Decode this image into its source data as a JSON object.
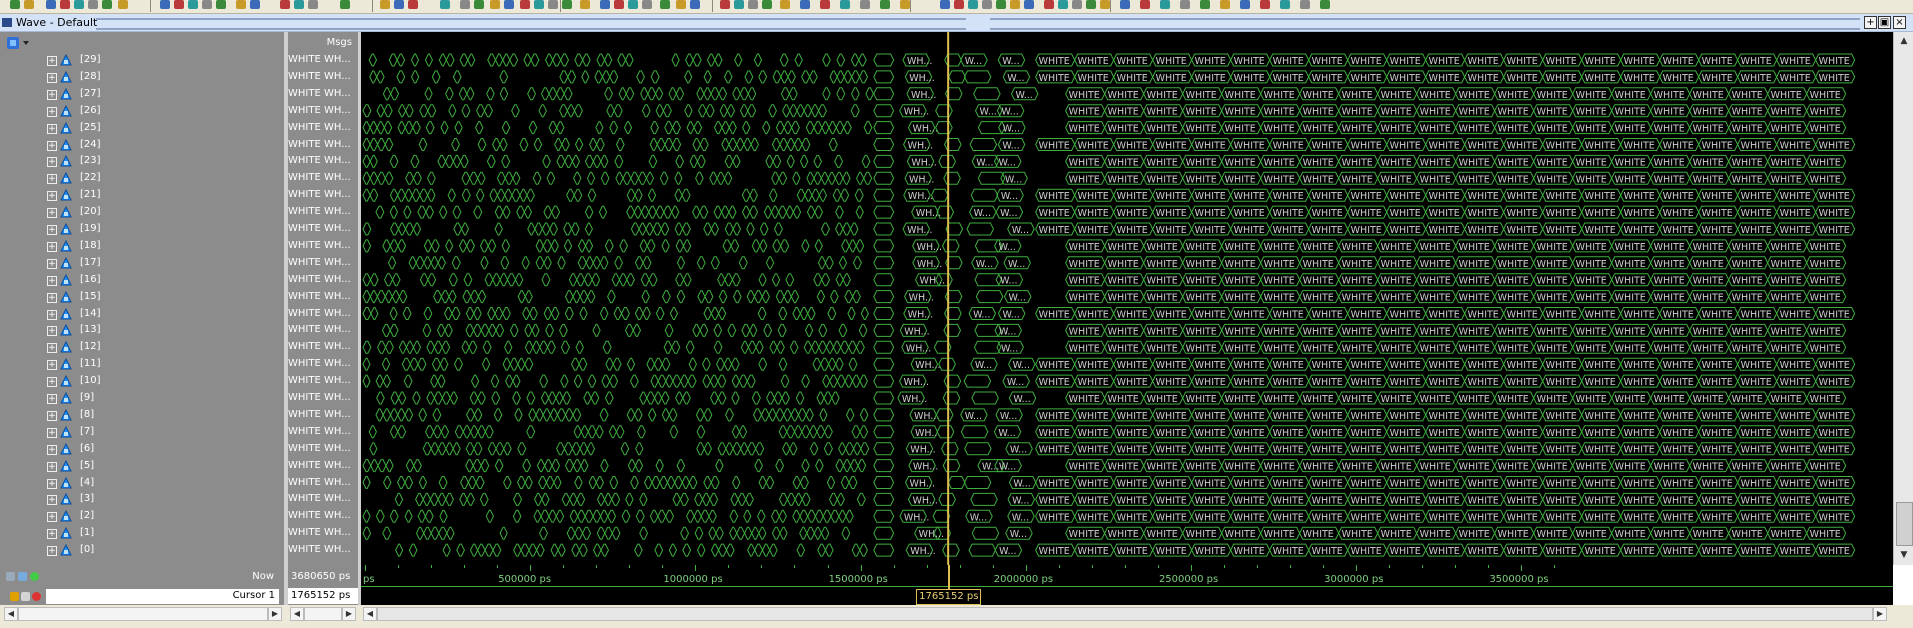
{
  "window": {
    "title": "Wave - Default"
  },
  "colors": {
    "pane_bg": "#8c8c8c",
    "wave_bg": "#000000",
    "wave_green": "#3fae3f",
    "wave_text": "#cfcfcf",
    "cursor": "#e0c050",
    "signal_icon": "#1e90ff"
  },
  "header": {
    "msgs": "Msgs"
  },
  "signals": [
    {
      "name": "[29]",
      "value": "WHITE WH..."
    },
    {
      "name": "[28]",
      "value": "WHITE WH..."
    },
    {
      "name": "[27]",
      "value": "WHITE WH..."
    },
    {
      "name": "[26]",
      "value": "WHITE WH..."
    },
    {
      "name": "[25]",
      "value": "WHITE WH..."
    },
    {
      "name": "[24]",
      "value": "WHITE WH..."
    },
    {
      "name": "[23]",
      "value": "WHITE WH..."
    },
    {
      "name": "[22]",
      "value": "WHITE WH..."
    },
    {
      "name": "[21]",
      "value": "WHITE WH..."
    },
    {
      "name": "[20]",
      "value": "WHITE WH..."
    },
    {
      "name": "[19]",
      "value": "WHITE WH..."
    },
    {
      "name": "[18]",
      "value": "WHITE WH..."
    },
    {
      "name": "[17]",
      "value": "WHITE WH..."
    },
    {
      "name": "[16]",
      "value": "WHITE WH..."
    },
    {
      "name": "[15]",
      "value": "WHITE WH..."
    },
    {
      "name": "[14]",
      "value": "WHITE WH..."
    },
    {
      "name": "[13]",
      "value": "WHITE WH..."
    },
    {
      "name": "[12]",
      "value": "WHITE WH..."
    },
    {
      "name": "[11]",
      "value": "WHITE WH..."
    },
    {
      "name": "[10]",
      "value": "WHITE WH..."
    },
    {
      "name": "[9]",
      "value": "WHITE WH..."
    },
    {
      "name": "[8]",
      "value": "WHITE WH..."
    },
    {
      "name": "[7]",
      "value": "WHITE WH..."
    },
    {
      "name": "[6]",
      "value": "WHITE WH..."
    },
    {
      "name": "[5]",
      "value": "WHITE WH..."
    },
    {
      "name": "[4]",
      "value": "WHITE WH..."
    },
    {
      "name": "[3]",
      "value": "WHITE WH..."
    },
    {
      "name": "[2]",
      "value": "WHITE WH..."
    },
    {
      "name": "[1]",
      "value": "WHITE WH..."
    },
    {
      "name": "[0]",
      "value": "WHITE WH..."
    }
  ],
  "wave_labels": {
    "short": "W...",
    "medium": "WH...",
    "word": "WHITE",
    "long": "WHITE WHITE..."
  },
  "status": {
    "now_label": "Now",
    "now_value": "3680650 ps",
    "cursor_label": "Cursor 1",
    "cursor_value": "1765152 ps"
  },
  "timeline": {
    "start_label": "ps",
    "ticks": [
      "500000 ps",
      "1000000 ps",
      "1500000 ps",
      "2000000 ps",
      "2500000 ps",
      "3000000 ps",
      "3500000 ps"
    ],
    "cursor_tag": "1765152 ps",
    "range_ps": [
      0,
      3680650
    ],
    "tick_values_ps": [
      500000,
      1000000,
      1500000,
      2000000,
      2500000,
      3000000,
      3500000
    ],
    "cursor_ps": 1765152
  },
  "icons": [
    "window-icon",
    "expand-icon",
    "signal-icon",
    "add-wave-icon",
    "lock-icon",
    "pencil-icon",
    "delete-icon",
    "maximize-icon",
    "restore-icon",
    "close-icon"
  ]
}
